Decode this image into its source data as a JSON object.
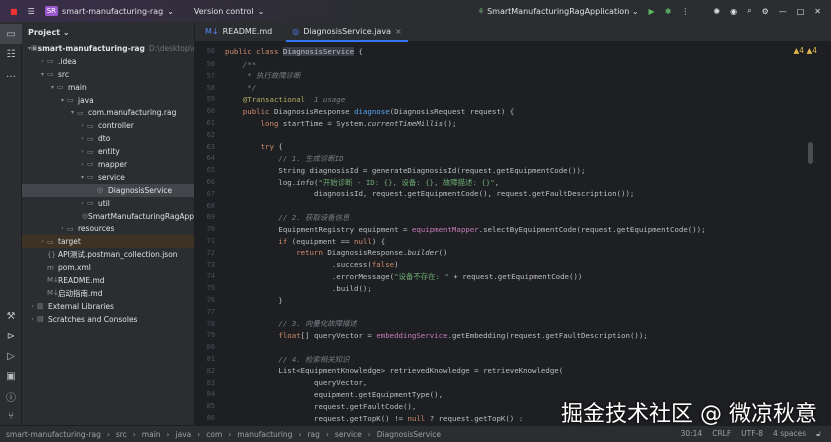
{
  "titlebar": {
    "project_badge": "SR",
    "project": "smart-manufacturing-rag",
    "vcs": "Version control",
    "run_config": "SmartManufacturingRagApplication"
  },
  "project_panel": {
    "title": "Project",
    "tree": [
      {
        "label": "smart-manufacturing-rag",
        "hint": "D:\\desktop\\oper",
        "depth": 0,
        "arrow": "▾",
        "icon": "▣",
        "bold": true
      },
      {
        "label": ".idea",
        "depth": 1,
        "arrow": "›",
        "icon": "▭"
      },
      {
        "label": "src",
        "depth": 1,
        "arrow": "▾",
        "icon": "▭"
      },
      {
        "label": "main",
        "depth": 2,
        "arrow": "▾",
        "icon": "▭"
      },
      {
        "label": "java",
        "depth": 3,
        "arrow": "▾",
        "icon": "▭"
      },
      {
        "label": "com.manufacturing.rag",
        "depth": 4,
        "arrow": "▾",
        "icon": "▭"
      },
      {
        "label": "controller",
        "depth": 5,
        "arrow": "›",
        "icon": "▭"
      },
      {
        "label": "dto",
        "depth": 5,
        "arrow": "›",
        "icon": "▭"
      },
      {
        "label": "entity",
        "depth": 5,
        "arrow": "›",
        "icon": "▭"
      },
      {
        "label": "mapper",
        "depth": 5,
        "arrow": "›",
        "icon": "▭"
      },
      {
        "label": "service",
        "depth": 5,
        "arrow": "▾",
        "icon": "▭"
      },
      {
        "label": "DiagnosisService",
        "depth": 6,
        "arrow": "",
        "icon": "◎",
        "selected": true
      },
      {
        "label": "util",
        "depth": 5,
        "arrow": "›",
        "icon": "▭"
      },
      {
        "label": "SmartManufacturingRagApp",
        "depth": 5,
        "arrow": "",
        "icon": "◎"
      },
      {
        "label": "resources",
        "depth": 3,
        "arrow": "›",
        "icon": "▭"
      },
      {
        "label": "target",
        "depth": 1,
        "arrow": "›",
        "icon": "▭",
        "excluded": true
      },
      {
        "label": "API测试.postman_collection.json",
        "depth": 1,
        "arrow": "",
        "icon": "{}"
      },
      {
        "label": "pom.xml",
        "depth": 1,
        "arrow": "",
        "icon": "m"
      },
      {
        "label": "README.md",
        "depth": 1,
        "arrow": "",
        "icon": "M↓"
      },
      {
        "label": "启动指南.md",
        "depth": 1,
        "arrow": "",
        "icon": "M↓"
      },
      {
        "label": "External Libraries",
        "depth": 0,
        "arrow": "›",
        "icon": "▥"
      },
      {
        "label": "Scratches and Consoles",
        "depth": 0,
        "arrow": "›",
        "icon": "▤"
      }
    ]
  },
  "tabs": [
    {
      "label": "README.md",
      "icon": "M↓"
    },
    {
      "label": "DiagnosisService.java",
      "icon": "◎",
      "active": true,
      "close": "×"
    }
  ],
  "editor": {
    "warnings": "▲4 ▲4",
    "lines": [
      {
        "n": "50",
        "t": [
          [
            "public ",
            "kw"
          ],
          [
            "class ",
            "kw"
          ],
          [
            "DiagnosisService",
            "hl"
          ],
          [
            " {",
            ""
          ]
        ]
      },
      {
        "n": "56",
        "t": [
          [
            "    /**",
            "cm"
          ]
        ]
      },
      {
        "n": "57",
        "t": [
          [
            "     * 执行故障诊断",
            "cm"
          ]
        ]
      },
      {
        "n": "58",
        "t": [
          [
            "     */",
            "cm"
          ]
        ]
      },
      {
        "n": "59",
        "t": [
          [
            "    @Transactional",
            "an"
          ],
          [
            "  1 usage",
            "cm"
          ]
        ]
      },
      {
        "n": "60",
        "t": [
          [
            "    public ",
            "kw"
          ],
          [
            "DiagnosisResponse ",
            ""
          ],
          [
            "diagnose",
            "fn"
          ],
          [
            "(DiagnosisRequest request) {",
            ""
          ]
        ]
      },
      {
        "n": "61",
        "t": [
          [
            "        long ",
            "kw"
          ],
          [
            "startTime = System.",
            ""
          ],
          [
            "currentTimeMillis",
            "it"
          ],
          [
            "();",
            ""
          ]
        ]
      },
      {
        "n": "62",
        "t": []
      },
      {
        "n": "63",
        "t": [
          [
            "        try ",
            "kw"
          ],
          [
            "{",
            ""
          ]
        ]
      },
      {
        "n": "64",
        "t": [
          [
            "            // 1. 生成诊断ID",
            "cm"
          ]
        ]
      },
      {
        "n": "65",
        "t": [
          [
            "            String diagnosisId = generateDiagnosisId(request.getEquipmentCode());",
            ""
          ]
        ]
      },
      {
        "n": "66",
        "t": [
          [
            "            log.",
            ""
          ],
          [
            "info",
            "it"
          ],
          [
            "(",
            ""
          ],
          [
            "\"开始诊断 - ID: {}, 设备: {}, 故障描述: {}\"",
            "st"
          ],
          [
            ",",
            ""
          ]
        ]
      },
      {
        "n": "67",
        "t": [
          [
            "                    diagnosisId, request.getEquipmentCode(), request.getFaultDescription());",
            ""
          ]
        ]
      },
      {
        "n": "68",
        "t": []
      },
      {
        "n": "69",
        "t": [
          [
            "            // 2. 获取设备信息",
            "cm"
          ]
        ]
      },
      {
        "n": "70",
        "t": [
          [
            "            EquipmentRegistry equipment = ",
            ""
          ],
          [
            "equipmentMapper",
            "fl"
          ],
          [
            ".selectByEquipmentCode(request.getEquipmentCode());",
            ""
          ]
        ]
      },
      {
        "n": "71",
        "t": [
          [
            "            if ",
            "kw"
          ],
          [
            "(equipment == ",
            ""
          ],
          [
            "null",
            "kw"
          ],
          [
            ") {",
            ""
          ]
        ]
      },
      {
        "n": "72",
        "t": [
          [
            "                return ",
            "kw"
          ],
          [
            "DiagnosisResponse.",
            ""
          ],
          [
            "builder",
            "it"
          ],
          [
            "()",
            ""
          ]
        ]
      },
      {
        "n": "73",
        "t": [
          [
            "                        .success(",
            ""
          ],
          [
            "false",
            "kw"
          ],
          [
            ")",
            ""
          ]
        ]
      },
      {
        "n": "74",
        "t": [
          [
            "                        .errorMessage(",
            ""
          ],
          [
            "\"设备不存在: \"",
            "st"
          ],
          [
            " + request.getEquipmentCode())",
            ""
          ]
        ]
      },
      {
        "n": "75",
        "t": [
          [
            "                        .build();",
            ""
          ]
        ]
      },
      {
        "n": "76",
        "t": [
          [
            "            }",
            ""
          ]
        ]
      },
      {
        "n": "77",
        "t": []
      },
      {
        "n": "78",
        "t": [
          [
            "            // 3. 向量化故障描述",
            "cm"
          ]
        ]
      },
      {
        "n": "79",
        "t": [
          [
            "            float",
            "kw"
          ],
          [
            "[] queryVector = ",
            ""
          ],
          [
            "embeddingService",
            "fl"
          ],
          [
            ".getEmbedding(request.getFaultDescription());",
            ""
          ]
        ]
      },
      {
        "n": "80",
        "t": []
      },
      {
        "n": "81",
        "t": [
          [
            "            // 4. 检索相关知识",
            "cm"
          ]
        ]
      },
      {
        "n": "82",
        "t": [
          [
            "            List<EquipmentKnowledge> retrievedKnowledge = retrieveKnowledge(",
            ""
          ]
        ]
      },
      {
        "n": "83",
        "t": [
          [
            "                    queryVector,",
            ""
          ]
        ]
      },
      {
        "n": "84",
        "t": [
          [
            "                    equipment.getEquipmentType(),",
            ""
          ]
        ]
      },
      {
        "n": "85",
        "t": [
          [
            "                    request.getFaultCode(),",
            ""
          ]
        ]
      },
      {
        "n": "86",
        "t": [
          [
            "                    request.getTopK() != ",
            ""
          ],
          [
            "null",
            "kw"
          ],
          [
            " ? request.getTopK() : ",
            ""
          ]
        ]
      }
    ]
  },
  "statusbar": {
    "breadcrumbs": [
      "smart-manufacturing-rag",
      "src",
      "main",
      "java",
      "com",
      "manufacturing",
      "rag",
      "service",
      "DiagnosisService"
    ],
    "position": "30:14",
    "line_sep": "CRLF",
    "encoding": "UTF-8",
    "indent": "4 spaces"
  },
  "watermark": "掘金技术社区 @ 微凉秋意"
}
